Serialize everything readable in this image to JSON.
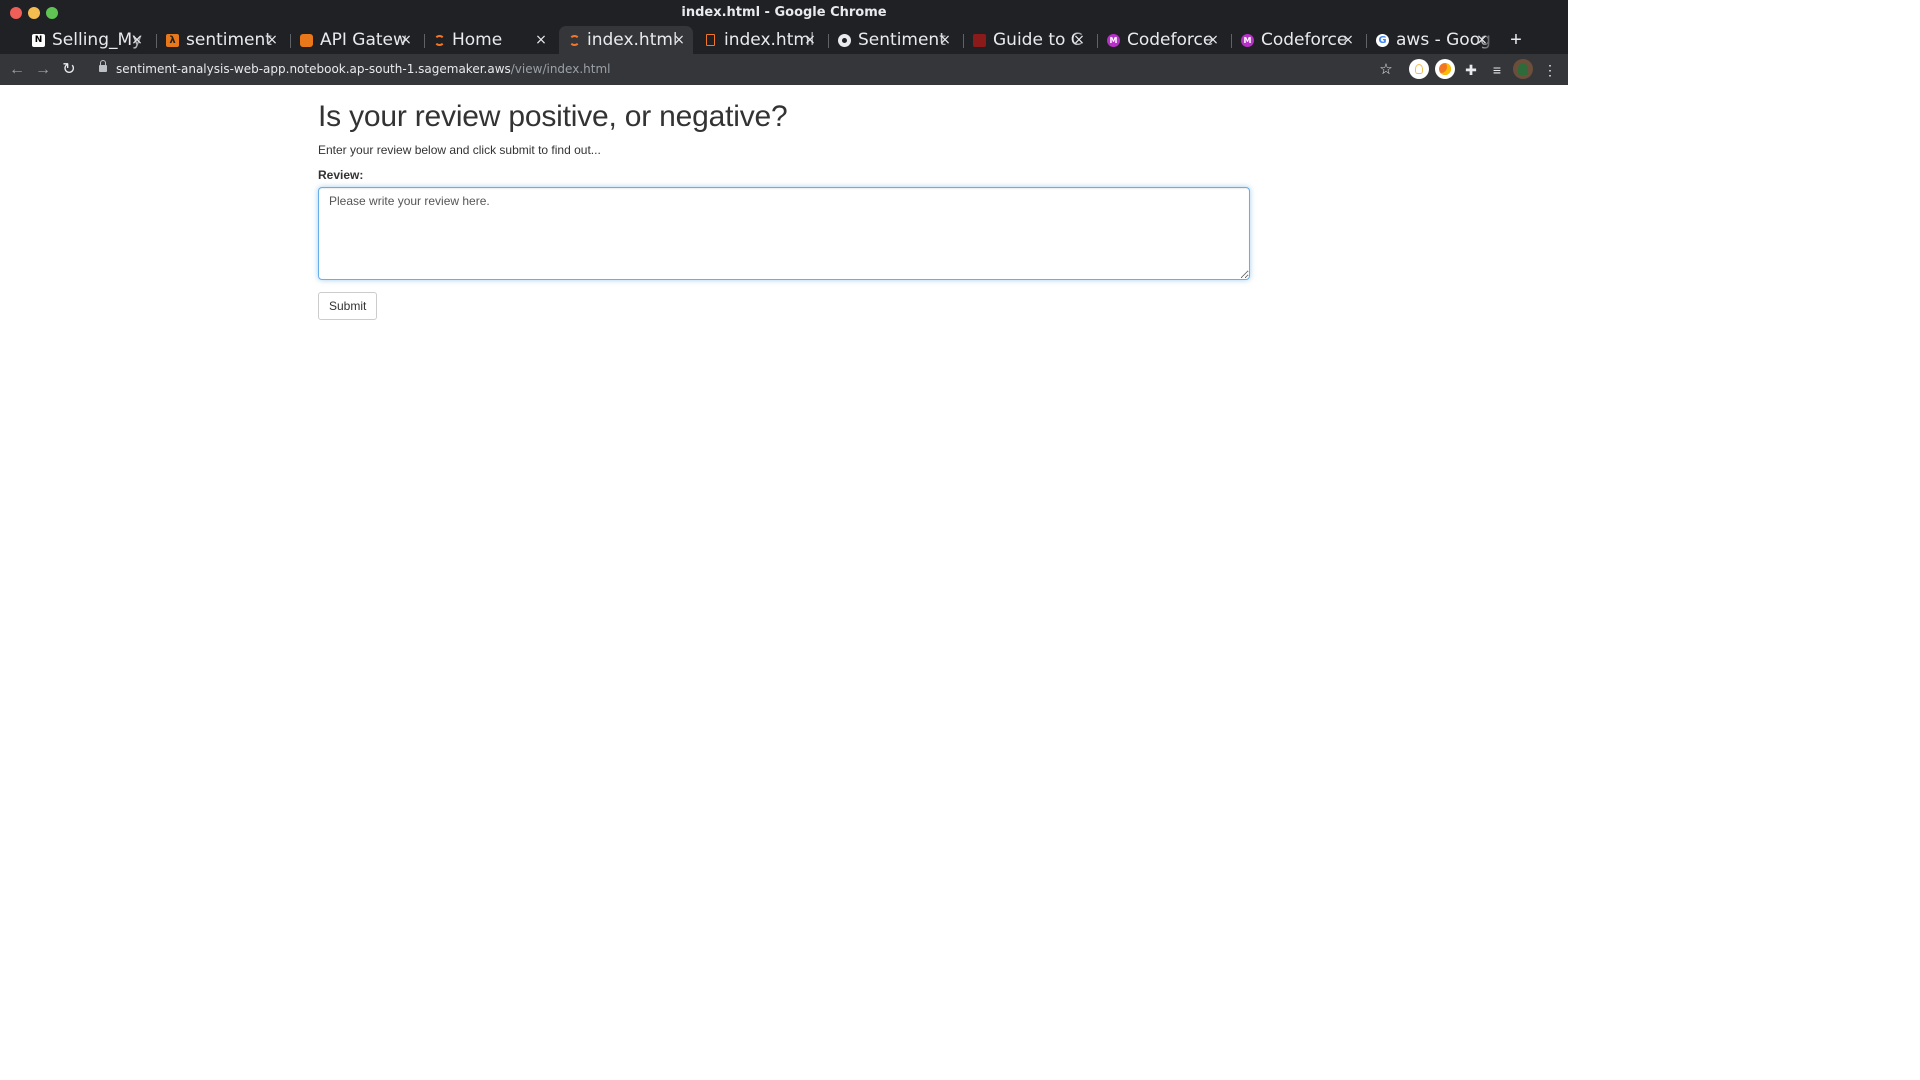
{
  "window": {
    "title": "index.html - Google Chrome"
  },
  "tabs": [
    {
      "label": "Selling_My",
      "favicon": "notion-icon",
      "color": "#ffffff",
      "active": false
    },
    {
      "label": "sentiment",
      "favicon": "aws-lambda-icon",
      "color": "#e8781a",
      "active": false
    },
    {
      "label": "API Gatew",
      "favicon": "aws-api-gateway-icon",
      "color": "#e8781a",
      "active": false
    },
    {
      "label": "Home",
      "favicon": "jupyter-icon",
      "color": "#f37626",
      "active": false
    },
    {
      "label": "index.html",
      "favicon": "jupyter-icon",
      "color": "#f37626",
      "active": true
    },
    {
      "label": "index.html",
      "favicon": "file-icon",
      "color": "#f37626",
      "active": false
    },
    {
      "label": "Sentiment",
      "favicon": "github-icon",
      "color": "#e8eaed",
      "active": false
    },
    {
      "label": "Guide to C",
      "favicon": "site-icon",
      "color": "#8b1a1a",
      "active": false
    },
    {
      "label": "Codeforce",
      "favicon": "codeforces-m-icon",
      "color": "#b82fc9",
      "active": false
    },
    {
      "label": "Codeforce",
      "favicon": "codeforces-m-icon",
      "color": "#b82fc9",
      "active": false
    },
    {
      "label": "aws - Goog",
      "favicon": "google-icon",
      "color": "#4285f4",
      "active": false
    }
  ],
  "toolbar": {
    "url_host": "sentiment-analysis-web-app.notebook.ap-south-1.sagemaker.aws",
    "url_path": "/view/index.html"
  },
  "page": {
    "heading": "Is your review positive, or negative?",
    "intro": "Enter your review below and click submit to find out...",
    "review_label": "Review:",
    "review_value": "Please write your review here.",
    "submit_label": "Submit"
  }
}
